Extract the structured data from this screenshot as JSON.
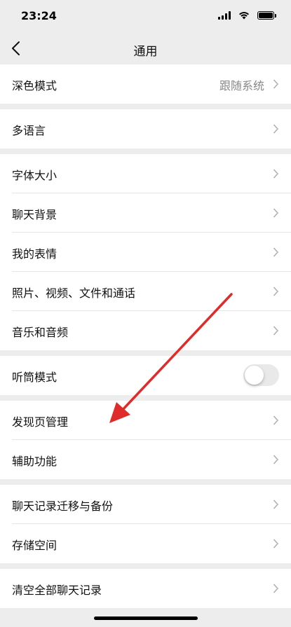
{
  "status_bar": {
    "time": "23:24"
  },
  "nav": {
    "title": "通用"
  },
  "groups": [
    {
      "items": [
        {
          "label": "深色模式",
          "value": "跟随系统"
        }
      ]
    },
    {
      "items": [
        {
          "label": "多语言"
        }
      ]
    },
    {
      "items": [
        {
          "label": "字体大小"
        },
        {
          "label": "聊天背景"
        },
        {
          "label": "我的表情"
        },
        {
          "label": "照片、视频、文件和通话"
        },
        {
          "label": "音乐和音频"
        }
      ]
    },
    {
      "items": [
        {
          "label": "听筒模式",
          "toggle": false
        }
      ]
    },
    {
      "items": [
        {
          "label": "发现页管理"
        },
        {
          "label": "辅助功能"
        }
      ]
    },
    {
      "items": [
        {
          "label": "聊天记录迁移与备份"
        },
        {
          "label": "存储空间"
        }
      ]
    },
    {
      "items": [
        {
          "label": "清空全部聊天记录"
        }
      ]
    }
  ],
  "colors": {
    "background": "#ededed",
    "annotation_arrow": "#e02b2b"
  }
}
